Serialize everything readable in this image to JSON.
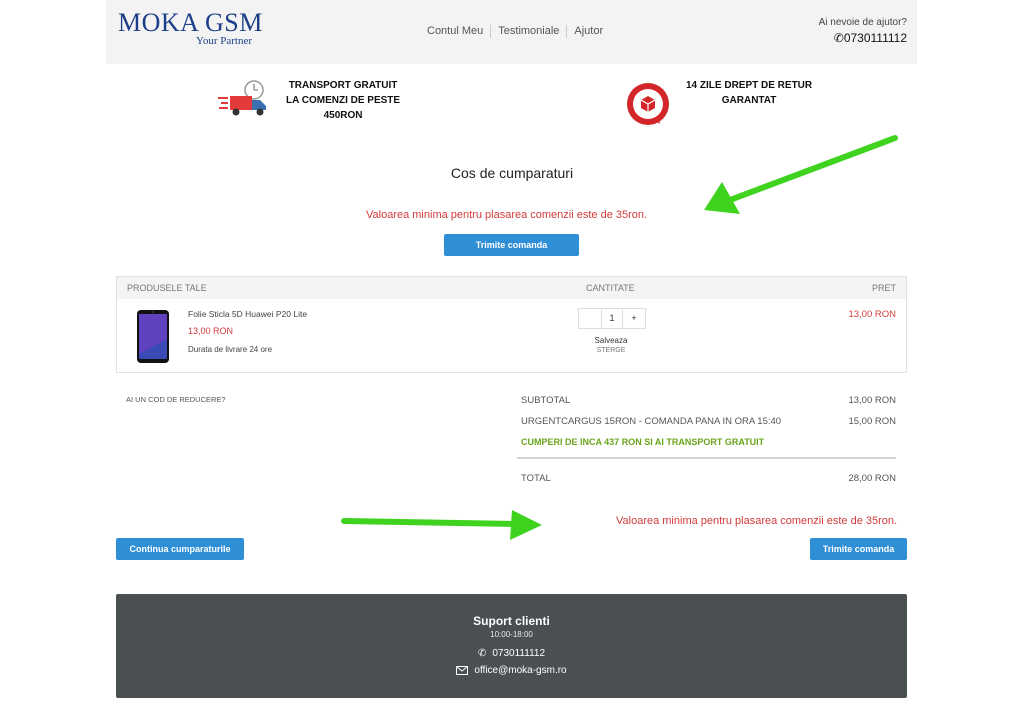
{
  "header": {
    "logo_main": "MOKA GSM",
    "logo_sub": "Your Partner",
    "nav": [
      "Contul Meu",
      "Testimoniale",
      "Ajutor"
    ],
    "help_question": "Ai nevoie de ajutor?",
    "help_phone": "0730111112"
  },
  "benefits": {
    "shipping": [
      "TRANSPORT GRATUIT",
      "LA COMENZI DE PESTE",
      "450RON"
    ],
    "returns": [
      "14 ZILE DREPT DE RETUR",
      "GARANTAT"
    ]
  },
  "cart": {
    "title": "Cos de cumparaturi",
    "min_message": "Valoarea minima pentru plasarea comenzii este de 35ron.",
    "submit_label": "Trimite comanda",
    "continue_label": "Continua cumparaturile"
  },
  "table": {
    "headers": [
      "PRODUSELE TALE",
      "CANTITATE",
      "PRET"
    ],
    "item": {
      "name": "Folie Sticla 5D Huawei P20 Lite",
      "unit_price": "13,00 RON",
      "delivery": "Durata de livrare 24 ore",
      "qty_minus": "",
      "qty_value": "1",
      "qty_plus": "+",
      "save_label": "Salveaza",
      "delete_label": "STERGE",
      "row_price": "13,00 RON"
    }
  },
  "totals": {
    "discount_label": "AI UN COD DE REDUCERE?",
    "subtotal_label": "SUBTOTAL",
    "subtotal_value": "13,00 RON",
    "shipping_label": "URGENTCARGUS 15RON - COMANDA PANA IN ORA 15:40",
    "shipping_value": "15,00 RON",
    "free_shipping_note": "CUMPERI DE INCA 437 RON SI AI TRANSPORT GRATUIT",
    "total_label": "TOTAL",
    "total_value": "28,00 RON"
  },
  "footer": {
    "title": "Suport clienti",
    "hours": "10:00-18:00",
    "phone": "0730111112",
    "email": "office@moka-gsm.ro"
  },
  "colors": {
    "brand": "#1d3f8a",
    "button": "#2f8fd6",
    "error": "#d23b3b",
    "success": "#6aa31a",
    "annotation_arrow": "#3fd31f",
    "footer_bg": "#4a4f52"
  }
}
